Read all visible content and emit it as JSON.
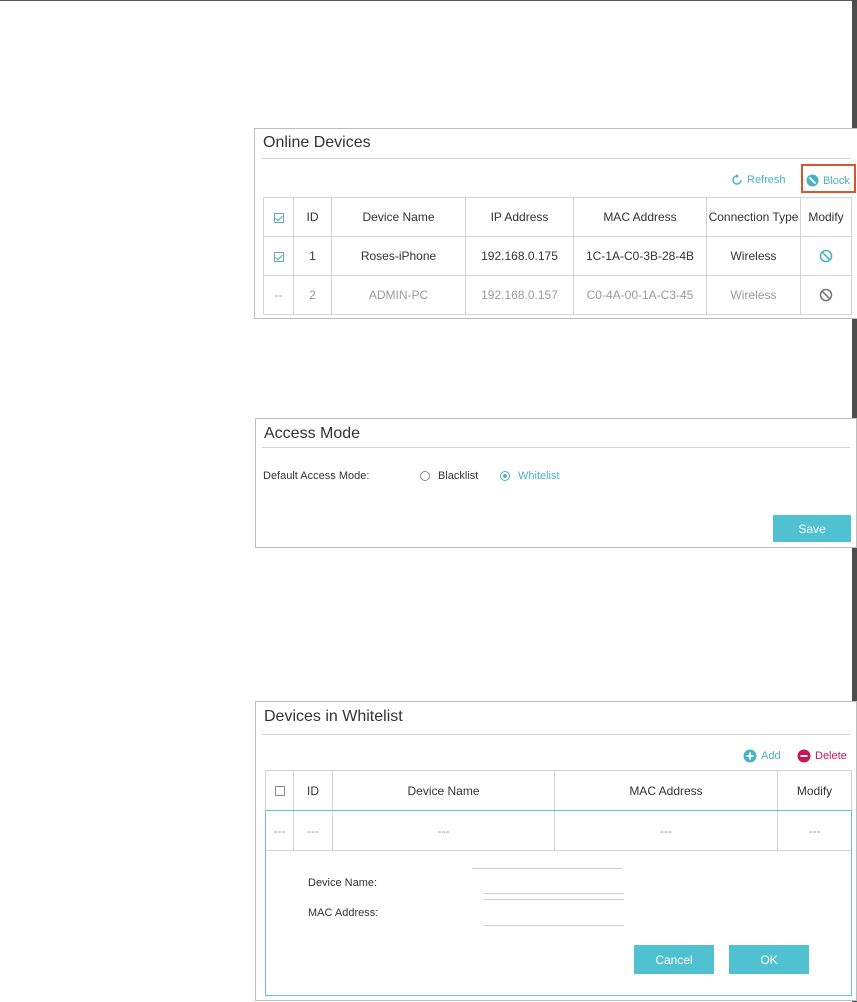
{
  "online_devices": {
    "title": "Online Devices",
    "refresh_label": "Refresh",
    "block_label": "Block",
    "columns": [
      "ID",
      "Device Name",
      "IP Address",
      "MAC Address",
      "Connection Type",
      "Modify"
    ],
    "rows": [
      {
        "id": "1",
        "name": "Roses-iPhone",
        "ip": "192.168.0.175",
        "mac": "1C-1A-C0-3B-28-4B",
        "type": "Wireless"
      },
      {
        "id": "2",
        "name": "ADMIN-PC",
        "ip": "192.168.0.157",
        "mac": "C0-4A-00-1A-C3-45",
        "type": "Wireless"
      }
    ],
    "dash": "--"
  },
  "access_mode": {
    "title": "Access Mode",
    "default_label": "Default Access Mode:",
    "blacklist_label": "Blacklist",
    "whitelist_label": "Whitelist",
    "save_label": "Save"
  },
  "whitelist": {
    "title": "Devices in Whitelist",
    "add_label": "Add",
    "delete_label": "Delete",
    "columns": [
      "ID",
      "Device Name",
      "MAC Address",
      "Modify"
    ],
    "empty_cell": "---",
    "device_name_label": "Device Name:",
    "mac_address_label": "MAC Address:",
    "cancel_label": "Cancel",
    "ok_label": "OK"
  },
  "colors": {
    "accent": "#4fc1d0",
    "highlight": "#d9562b",
    "delete": "#c2185b"
  }
}
